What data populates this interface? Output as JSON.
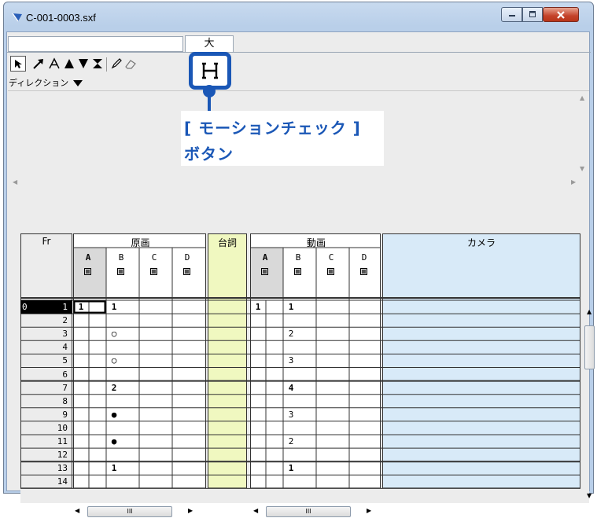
{
  "window": {
    "title": "C-001-0003.sxf"
  },
  "header": {
    "name_value": "",
    "tab_label": "大"
  },
  "toolbar": {
    "direction_label": "ディレクション"
  },
  "callout": {
    "line1": "[ モーションチェック ]",
    "line2": "ボタン"
  },
  "sheet": {
    "fr_label": "Fr",
    "genga_label": "原画",
    "serifu_label": "台詞",
    "douga_label": "動画",
    "camera_label": "カメラ",
    "genga_columns": [
      "A",
      "B",
      "C",
      "D"
    ],
    "douga_columns": [
      "A",
      "B",
      "C",
      "D"
    ],
    "frame_first_prefix": "0",
    "frames": [
      "1",
      "2",
      "3",
      "4",
      "5",
      "6",
      "7",
      "8",
      "9",
      "10",
      "11",
      "12",
      "13",
      "14"
    ],
    "genga_A": [
      "1",
      "",
      "",
      "",
      "",
      "",
      "",
      "",
      "",
      "",
      "",
      "",
      "",
      ""
    ],
    "genga_B": [
      "1",
      "",
      "○",
      "",
      "○",
      "",
      "2",
      "",
      "●",
      "",
      "●",
      "",
      "1",
      ""
    ],
    "douga_A": [
      "1",
      "",
      "",
      "",
      "",
      "",
      "",
      "",
      "",
      "",
      "",
      "",
      "",
      ""
    ],
    "douga_B": [
      "1",
      "",
      "2",
      "",
      "3",
      "",
      "4",
      "",
      "3",
      "",
      "2",
      "",
      "1",
      ""
    ]
  },
  "scrollbar": {
    "grip": "III"
  },
  "colors": {
    "accent_blue": "#1a57b6",
    "serifu_bg": "#f0f8c0",
    "camera_bg": "#d8eaf8"
  }
}
